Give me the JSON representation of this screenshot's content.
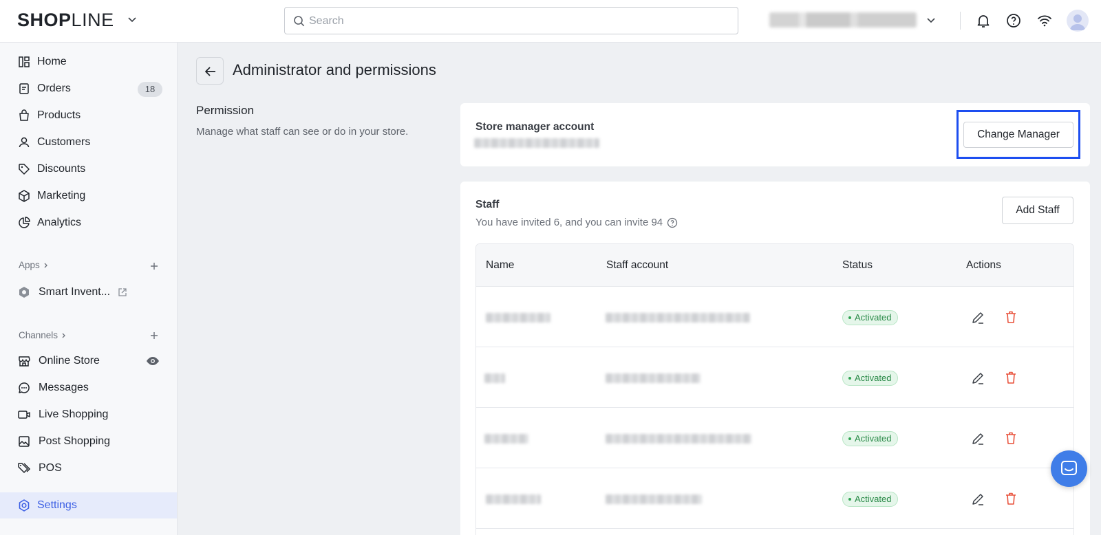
{
  "header": {
    "logo_left": "SH",
    "logo_o": "O",
    "logo_p": "P",
    "logo_right": "LINE",
    "search_placeholder": "Search",
    "store_name_blurred": "",
    "icons": [
      "bell-icon",
      "help-icon",
      "wifi-icon",
      "avatar"
    ]
  },
  "sidebar": {
    "items": [
      {
        "label": "Home",
        "icon": "home-icon"
      },
      {
        "label": "Orders",
        "icon": "orders-icon",
        "badge": "18"
      },
      {
        "label": "Products",
        "icon": "bag-icon"
      },
      {
        "label": "Customers",
        "icon": "user-icon"
      },
      {
        "label": "Discounts",
        "icon": "tag-icon"
      },
      {
        "label": "Marketing",
        "icon": "cube-icon"
      },
      {
        "label": "Analytics",
        "icon": "pie-chart-icon"
      }
    ],
    "apps_heading": "Apps",
    "apps": [
      {
        "label": "Smart Invent...",
        "icon": "hexagon-icon"
      }
    ],
    "channels_heading": "Channels",
    "channels": [
      {
        "label": "Online Store",
        "icon": "store-icon"
      },
      {
        "label": "Messages",
        "icon": "chat-icon"
      },
      {
        "label": "Live Shopping",
        "icon": "video-icon"
      },
      {
        "label": "Post Shopping",
        "icon": "image-icon"
      },
      {
        "label": "POS",
        "icon": "pos-tag-icon"
      }
    ],
    "settings": {
      "label": "Settings",
      "icon": "settings-gear-icon"
    }
  },
  "page": {
    "title": "Administrator and permissions",
    "permission_title": "Permission",
    "permission_desc": "Manage what staff can see or do in your store."
  },
  "store_manager": {
    "title": "Store manager account",
    "button": "Change Manager"
  },
  "staff": {
    "title": "Staff",
    "subtitle": "You have invited 6, and you can invite 94",
    "add_button": "Add Staff",
    "columns": [
      "Name",
      "Staff account",
      "Status",
      "Actions"
    ],
    "rows": [
      {
        "status": "Activated"
      },
      {
        "status": "Activated"
      },
      {
        "status": "Activated"
      },
      {
        "status": "Activated"
      }
    ]
  },
  "colors": {
    "accent": "#3c5fe4",
    "highlight": "#1d4ef0",
    "status_green": "#2a8a48",
    "delete_red": "#e8503a"
  }
}
